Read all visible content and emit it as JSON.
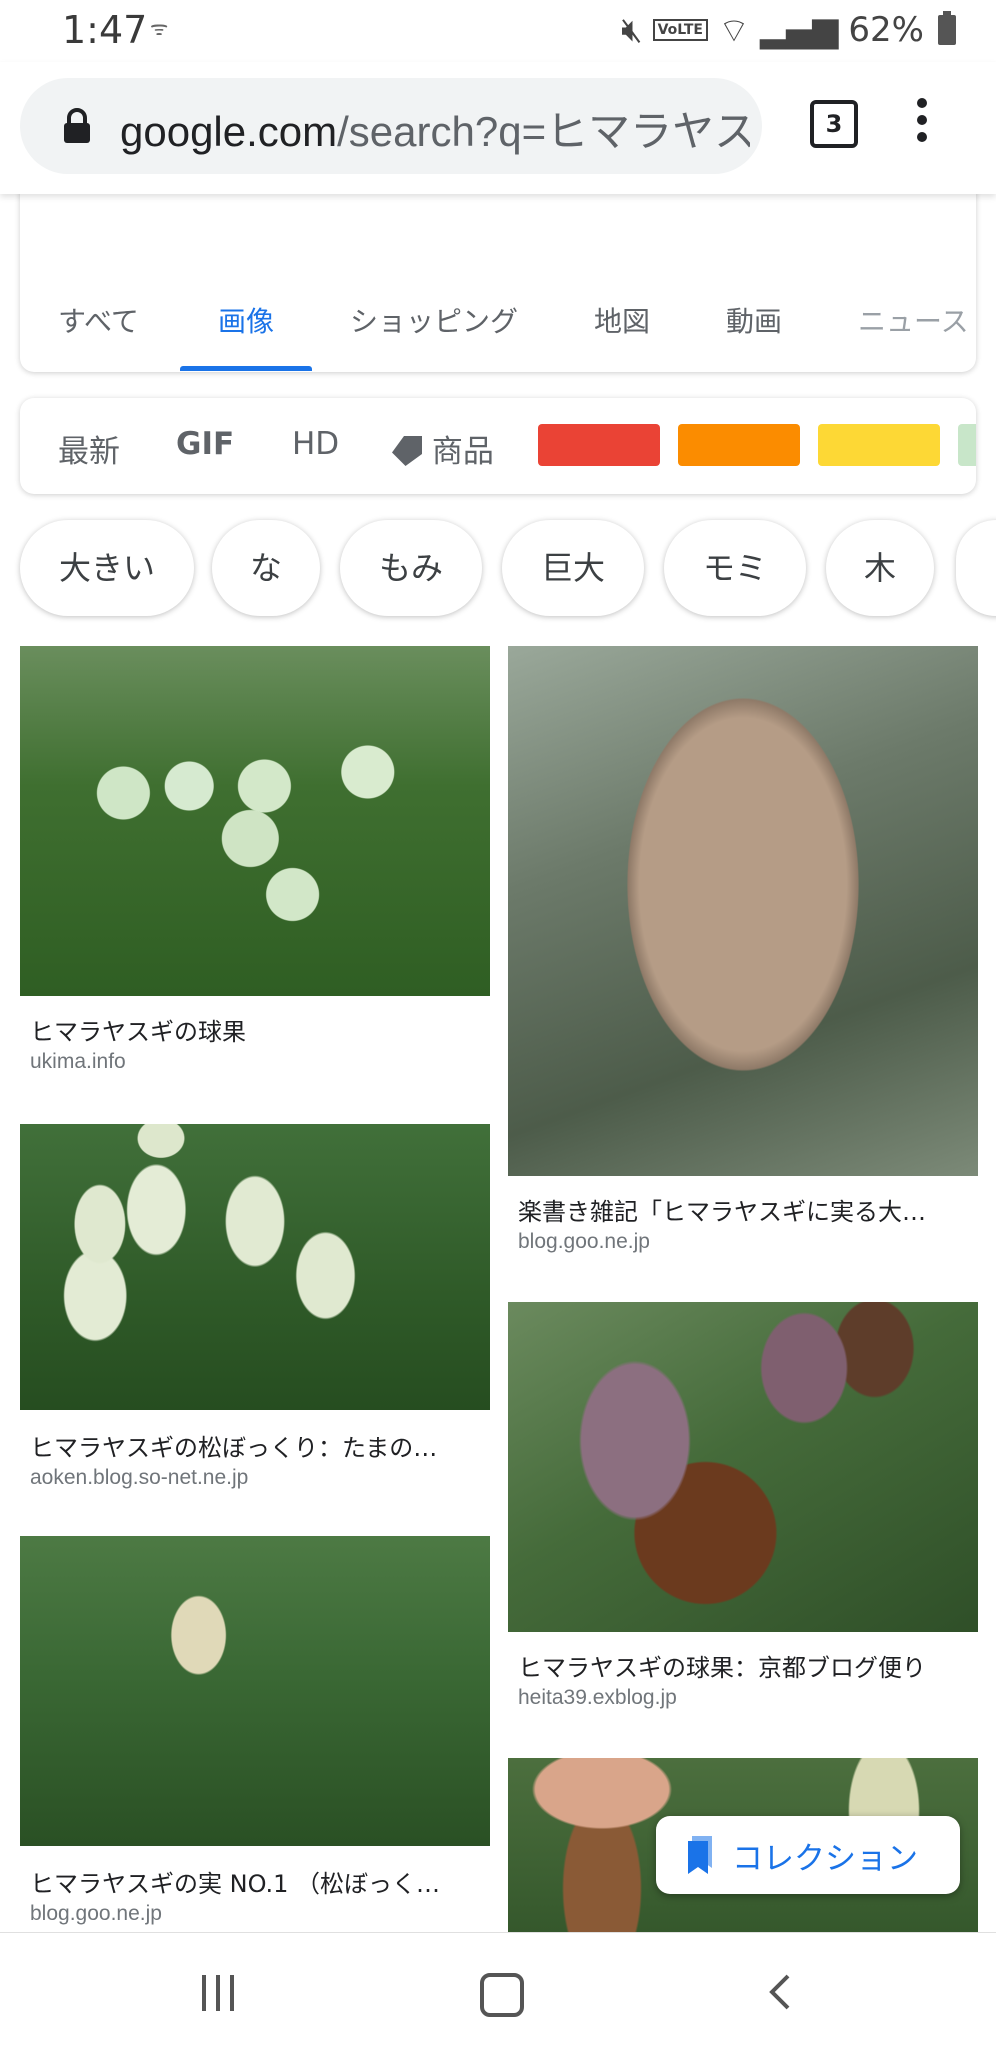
{
  "status_bar": {
    "time": "1:47",
    "battery": "62%"
  },
  "url_bar": {
    "host": "google.com",
    "path": "/search?q=ヒマラヤスギ",
    "tab_count": "3"
  },
  "search_tabs": [
    "すべて",
    "画像",
    "ショッピング",
    "地図",
    "動画",
    "ニュース"
  ],
  "active_tab": "画像",
  "filters": {
    "items": [
      "最新",
      "GIF",
      "HD",
      "商品"
    ],
    "color_swatches": [
      "#ea4335",
      "#fb8c00",
      "#fdd835",
      "#c8e6c9"
    ]
  },
  "chips": [
    "大きい",
    "な",
    "もみ",
    "巨大",
    "モミ",
    "木"
  ],
  "results": [
    {
      "title": "ヒマラヤスギの球果",
      "source": "ukima.info"
    },
    {
      "title": "楽書き雑記「ヒマラヤスギに実る大…",
      "source": "blog.goo.ne.jp"
    },
    {
      "title": "ヒマラヤスギの松ぼっくり：たまの…",
      "source": "aoken.blog.so-net.ne.jp"
    },
    {
      "title": "ヒマラヤスギの球果：京都ブログ便り",
      "source": "heita39.exblog.jp"
    },
    {
      "title": "ヒマラヤスギの実 NO.1 （松ぼっく…",
      "source": "blog.goo.ne.jp"
    }
  ],
  "collection_button": "コレクション"
}
